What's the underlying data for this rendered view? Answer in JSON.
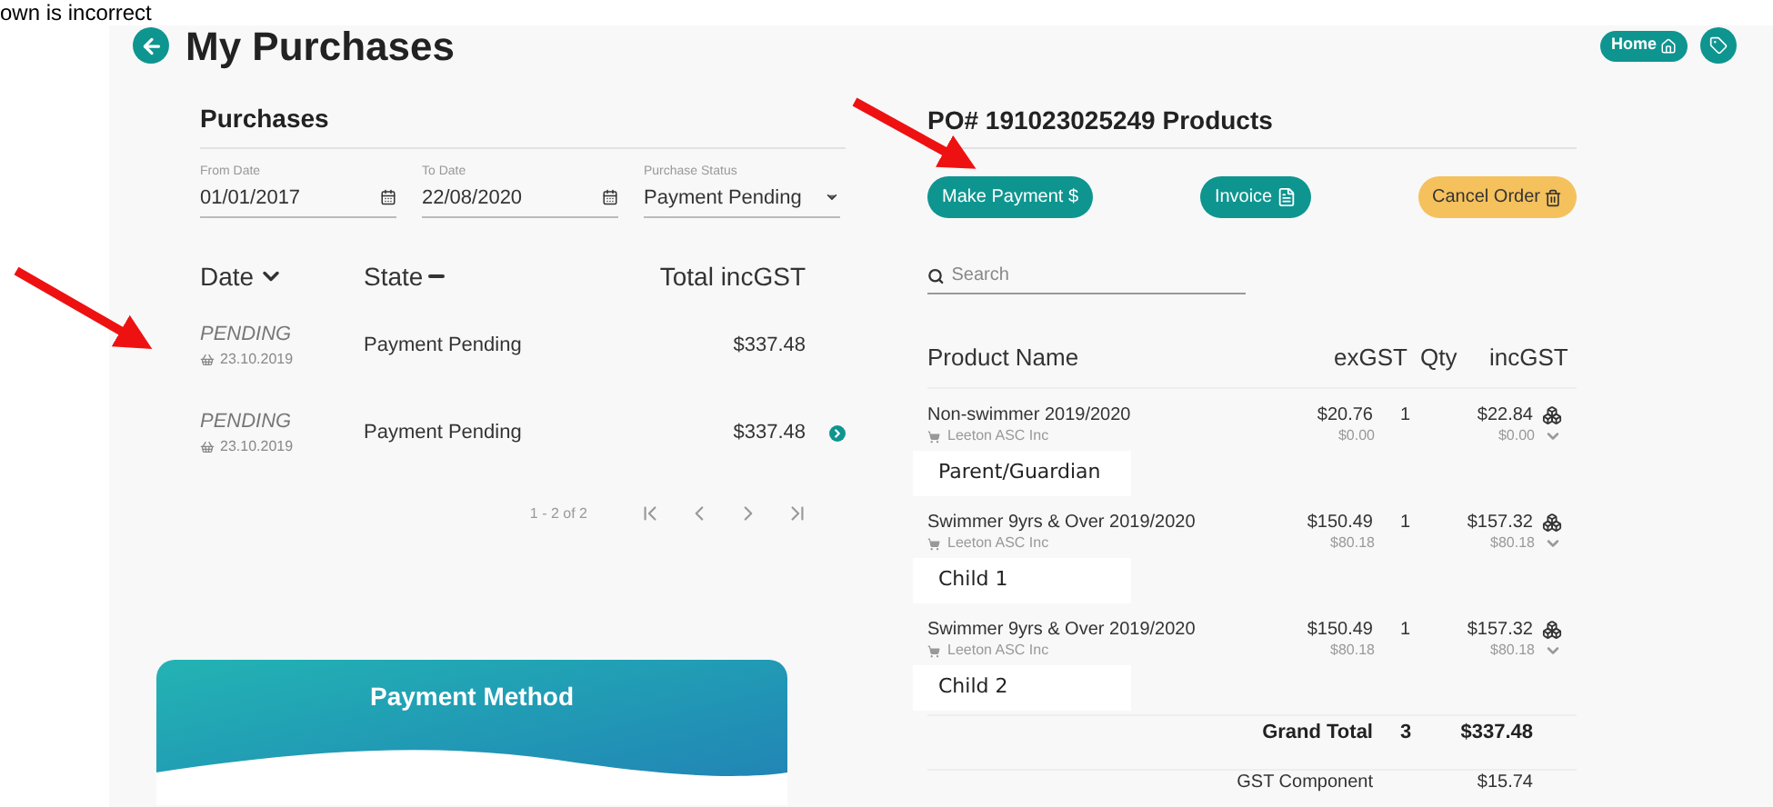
{
  "caption": "own is incorrect",
  "header": {
    "title": "My Purchases",
    "home_button": "Home"
  },
  "purchases": {
    "title": "Purchases",
    "filters": [
      {
        "kind": "date",
        "label": "From Date",
        "value": "01/01/2017"
      },
      {
        "kind": "date",
        "label": "To Date",
        "value": "22/08/2020"
      },
      {
        "kind": "select",
        "label": "Purchase Status",
        "value": "Payment Pending"
      }
    ],
    "columns": [
      "Date",
      "State",
      "Total incGST"
    ],
    "rows": [
      {
        "status": "PENDING",
        "date": "23.10.2019",
        "state": "Payment Pending",
        "total": "$337.48",
        "kind": "plain"
      },
      {
        "status": "PENDING",
        "date": "23.10.2019",
        "state": "Payment Pending",
        "total": "$337.48",
        "kind": "linked"
      }
    ],
    "pagination": "1 - 2 of 2"
  },
  "payment_method": {
    "title": "Payment Method"
  },
  "products": {
    "title": "PO# 191023025249 Products",
    "buttons": [
      {
        "label": "Make Payment $",
        "kind": "pay"
      },
      {
        "label": "Invoice",
        "kind": "invoice"
      },
      {
        "label": "Cancel Order",
        "kind": "cancel"
      }
    ],
    "search": {
      "placeholder": "Search"
    },
    "columns": [
      "Product Name",
      "exGST",
      "Qty",
      "incGST"
    ],
    "rows": [
      {
        "name": "Non-swimmer 2019/2020",
        "vendor": "Leeton ASC Inc",
        "ex_gst": "$20.76",
        "ex_gst_sub": "$0.00",
        "qty": "1",
        "inc_gst": "$22.84",
        "inc_gst_sub": "$0.00",
        "annotation": "Parent/Guardian"
      },
      {
        "name": "Swimmer 9yrs & Over 2019/2020",
        "vendor": "Leeton ASC Inc",
        "ex_gst": "$150.49",
        "ex_gst_sub": "$80.18",
        "qty": "1",
        "inc_gst": "$157.32",
        "inc_gst_sub": "$80.18",
        "annotation": "Child 1"
      },
      {
        "name": "Swimmer 9yrs & Over 2019/2020",
        "vendor": "Leeton ASC Inc",
        "ex_gst": "$150.49",
        "ex_gst_sub": "$80.18",
        "qty": "1",
        "inc_gst": "$157.32",
        "inc_gst_sub": "$80.18",
        "annotation": "Child 2"
      }
    ],
    "grand_total": {
      "label": "Grand Total",
      "qty": "3",
      "value": "$337.48"
    },
    "gst_component": {
      "label": "GST Component",
      "value": "$15.74"
    }
  }
}
